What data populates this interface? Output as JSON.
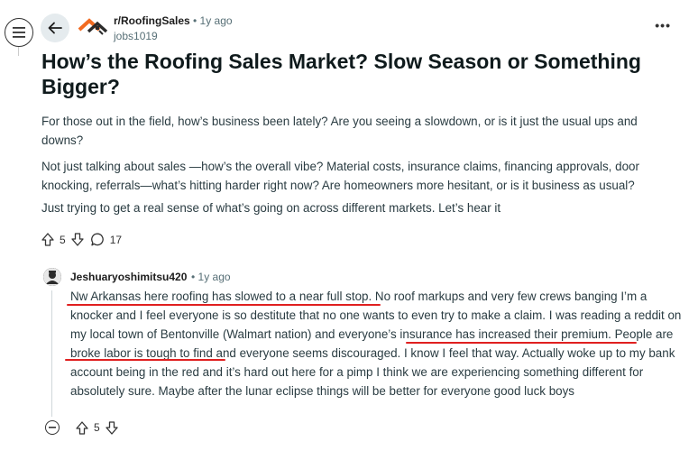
{
  "post": {
    "subreddit": "r/RoofingSales",
    "time": "• 1y ago",
    "author": "jobs1019",
    "more_label": "•••",
    "title": "How’s the Roofing Sales Market? Slow Season or Something Bigger?",
    "body": [
      "For those out in the field, how’s business been lately? Are you seeing a slowdown, or is it just the usual ups and downs?",
      "Not just talking about sales —how’s the overall vibe? Material costs, insurance claims, financing approvals, door knocking, referrals—what’s hitting harder right now? Are homeowners more hesitant, or is it business as usual?",
      "Just trying to get a real sense of what’s going on across different markets. Let’s hear it"
    ],
    "upvotes": "5",
    "comments": "17"
  },
  "comment": {
    "username": "Jeshuaryoshimitsu420",
    "time": "• 1y ago",
    "text": "Nw Arkansas here roofing has slowed to a near full stop. No roof markups and very few crews banging I’m a knocker and I feel everyone is so destitute that no one wants to even try to make a claim. I was reading a reddit on my local town of Bentonville (Walmart nation) and everyone’s insurance has increased their premium. People are broke labor is tough to find and everyone seems discouraged. I know I feel that way. Actually woke up to my bank account being in the red and it’s hard out here for a pimp I think we are experiencing something different for absolutely sure. Maybe after the lunar eclipse things will be better for everyone good luck boys",
    "upvotes": "5"
  },
  "colors": {
    "annotation": "#e02020",
    "back_button_bg": "#e5ebee",
    "logo_orange": "#f26b21"
  },
  "icons": [
    "menu-icon",
    "back-arrow-icon",
    "subreddit-logo-icon",
    "more-icon",
    "upvote-icon",
    "downvote-icon",
    "comment-icon",
    "collapse-icon"
  ]
}
